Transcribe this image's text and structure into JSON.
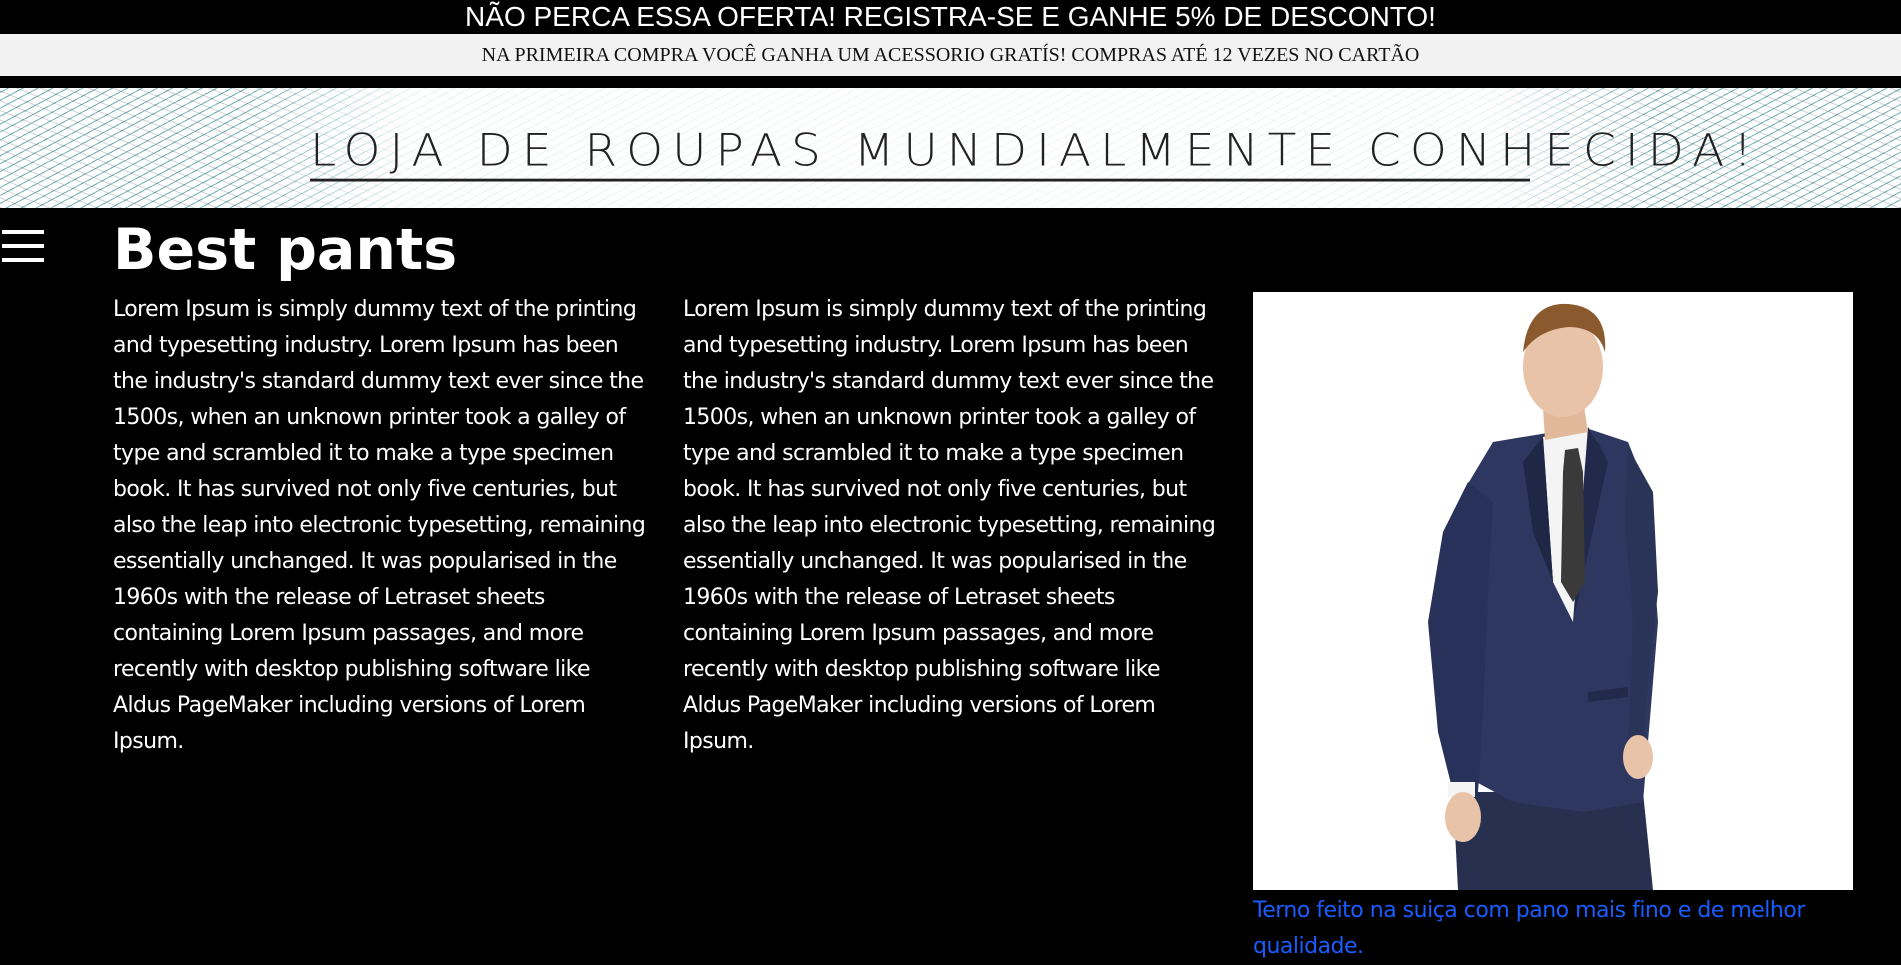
{
  "promo": {
    "headline": "NÃO PERCA ESSA OFERTA! REGISTRA-SE E GANHE 5% DE DESCONTO!",
    "subline": "NA PRIMEIRA COMPRA VOCÊ GANHA UM ACESSORIO GRATÍS! COMPRAS ATÉ 12 VEZES NO CARTÃO"
  },
  "hero": {
    "title": "LOJA DE ROUPAS MUNDIALMENTE CONHECIDA!"
  },
  "nav": {
    "menu_icon": "hamburger-menu-icon"
  },
  "main": {
    "title": "Best pants",
    "columns": [
      "Lorem Ipsum is simply dummy text of the printing and typesetting industry. Lorem Ipsum has been the industry's standard dummy text ever since the 1500s, when an unknown printer took a galley of type and scrambled it to make a type specimen book. It has survived not only five centuries, but also the leap into electronic typesetting, remaining essentially unchanged. It was popularised in the 1960s with the release of Letraset sheets containing Lorem Ipsum passages, and more recently with desktop publishing software like Aldus PageMaker including versions of Lorem Ipsum.",
      "Lorem Ipsum is simply dummy text of the printing and typesetting industry. Lorem Ipsum has been the industry's standard dummy text ever since the 1500s, when an unknown printer took a galley of type and scrambled it to make a type specimen book. It has survived not only five centuries, but also the leap into electronic typesetting, remaining essentially unchanged. It was popularised in the 1960s with the release of Letraset sheets containing Lorem Ipsum passages, and more recently with desktop publishing software like Aldus PageMaker including versions of Lorem Ipsum."
    ],
    "caption": "Terno feito na suiça com pano mais fino e de melhor qualidade."
  },
  "colors": {
    "background": "#000000",
    "text": "#ffffff",
    "caption_link": "#1a5cff",
    "sub_banner_bg": "#f2f2f2",
    "suit": "#2b3557"
  }
}
